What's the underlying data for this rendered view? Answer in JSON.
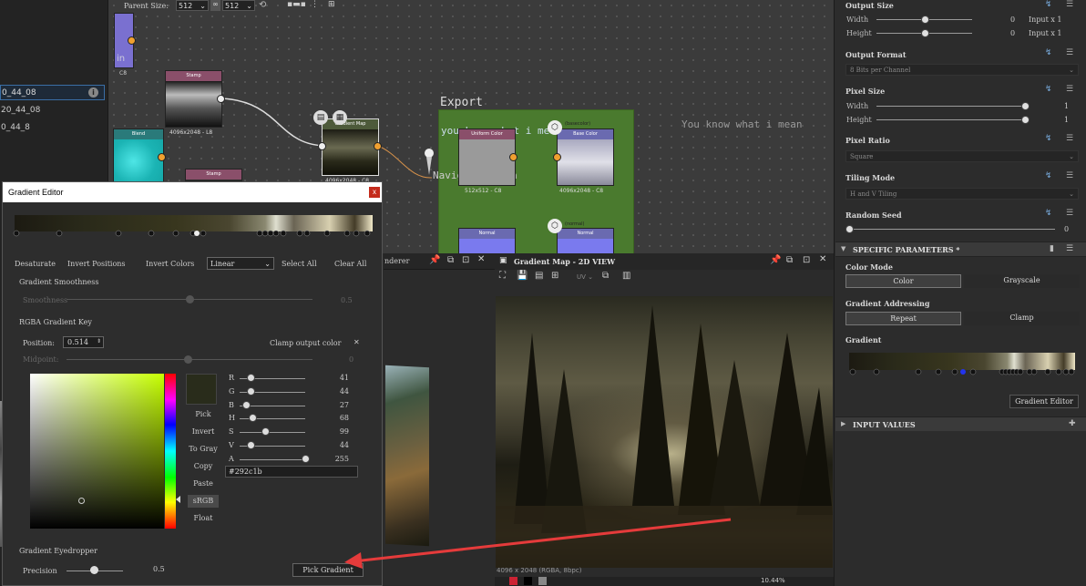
{
  "graph_toolbar": {
    "parent_size_label": "Parent Size:",
    "parent_size_value": "512",
    "size_value": "512"
  },
  "left_panel": {
    "items": [
      "0_44_08",
      "20_44_08",
      "0_44_8"
    ]
  },
  "graph": {
    "export_frame_title": "Export",
    "export_frame_text": "you know what i mean",
    "note_text": "You know what i mean",
    "nav_pin_label": "Navigation Pin",
    "nodes": {
      "in_label": "in",
      "in_caption": "C8",
      "stamp1_title": "Stamp",
      "stamp1_caption": "4096x2048 - L8",
      "gradmap_title": "Gradient Map",
      "gradmap_caption": "4096x2048 - C8",
      "blend_title": "Blend",
      "stamp2_title": "Stamp",
      "uniform_title": "Uniform Color",
      "uniform_caption": "512x512 - C8",
      "base_title": "Base Color",
      "base_tag": "(basecolor)",
      "base_caption": "4096x2048 - C8",
      "normal1_title": "Normal",
      "normal2_title": "Normal",
      "normal2_tag": "(normal)"
    }
  },
  "right_panel": {
    "output_size": {
      "title": "Output Size",
      "width_label": "Width",
      "width_value": "0",
      "width_suffix": "Input x 1",
      "height_label": "Height",
      "height_value": "0",
      "height_suffix": "Input x 1"
    },
    "output_format": {
      "title": "Output Format",
      "value": "8 Bits per Channel"
    },
    "pixel_size": {
      "title": "Pixel Size",
      "width_label": "Width",
      "width_value": "1",
      "height_label": "Height",
      "height_value": "1"
    },
    "pixel_ratio": {
      "title": "Pixel Ratio",
      "value": "Square"
    },
    "tiling_mode": {
      "title": "Tiling Mode",
      "value": "H and V Tiling"
    },
    "random_seed": {
      "title": "Random Seed",
      "value": "0"
    },
    "specific_parameters": {
      "title": "SPECIFIC PARAMETERS *"
    },
    "color_mode": {
      "title": "Color Mode",
      "option1": "Color",
      "option2": "Grayscale"
    },
    "gradient_addressing": {
      "title": "Gradient Addressing",
      "option1": "Repeat",
      "option2": "Clamp"
    },
    "gradient": {
      "title": "Gradient",
      "editor_button": "Gradient Editor"
    },
    "input_values": {
      "title": "INPUT VALUES"
    }
  },
  "gradient_editor": {
    "title": "Gradient Editor",
    "close": "x",
    "toolbar": {
      "desaturate": "Desaturate",
      "invert_positions": "Invert Positions",
      "invert_colors": "Invert Colors",
      "mode_value": "Linear",
      "select_all": "Select All",
      "clear_all": "Clear All"
    },
    "smoothness": {
      "section": "Gradient Smoothness",
      "label": "Smoothness",
      "value": "0.5"
    },
    "rgba_key": {
      "section": "RGBA Gradient Key",
      "position_label": "Position:",
      "position_value": "0.514",
      "clamp_label": "Clamp output color",
      "clamp_x": "✕",
      "midpoint_label": "Midpoint:",
      "midpoint_value": "0"
    },
    "channels": [
      {
        "label": "R",
        "value": "41",
        "pos": 0.16
      },
      {
        "label": "G",
        "value": "44",
        "pos": 0.17
      },
      {
        "label": "B",
        "value": "27",
        "pos": 0.1
      },
      {
        "label": "H",
        "value": "68",
        "pos": 0.19
      },
      {
        "label": "S",
        "value": "99",
        "pos": 0.39
      },
      {
        "label": "V",
        "value": "44",
        "pos": 0.17
      },
      {
        "label": "A",
        "value": "255",
        "pos": 1.0
      }
    ],
    "hex_value": "#292c1b",
    "side_buttons": [
      "Pick",
      "Invert",
      "To Gray",
      "Copy",
      "Paste",
      "sRGB",
      "Float"
    ],
    "eyedropper": {
      "section": "Gradient Eyedropper",
      "precision_label": "Precision",
      "precision_value": "0.5",
      "pick_button": "Pick Gradient"
    },
    "swatch_color": "#292c1b"
  },
  "view3d": {
    "title": "nderer"
  },
  "view2d": {
    "title": "Gradient Map - 2D VIEW",
    "dropdown": "UV",
    "status": "4096 x 2048 (RGBA, 8bpc)",
    "zoom": "10.44%"
  }
}
